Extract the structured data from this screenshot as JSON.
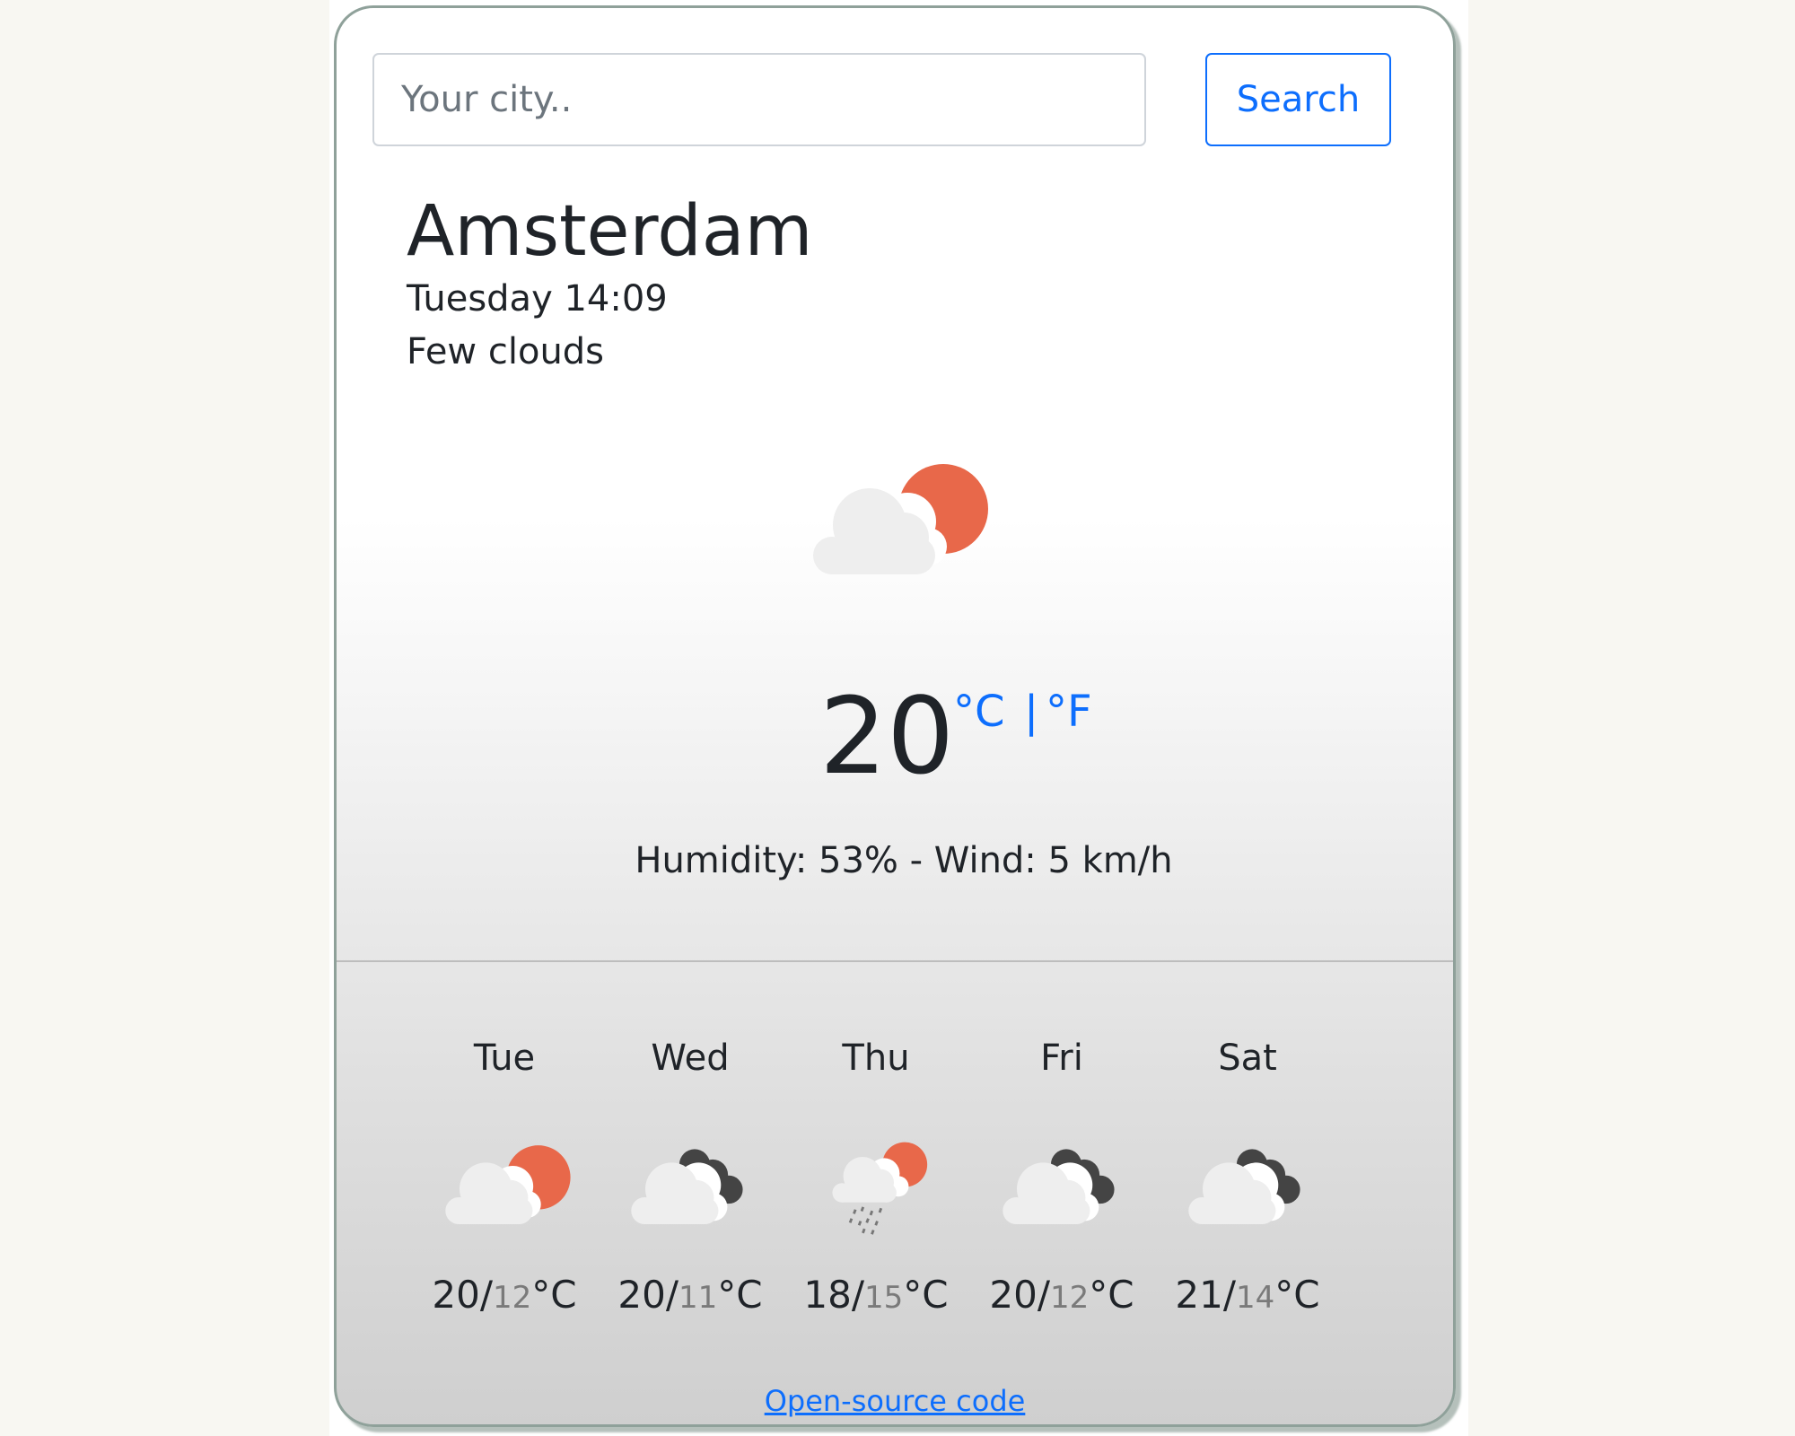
{
  "search": {
    "placeholder": "Your city..",
    "value": "",
    "button_label": "Search"
  },
  "current": {
    "city": "Amsterdam",
    "datetime": "Tuesday 14:09",
    "description": "Few clouds",
    "icon": "few-clouds-day-icon",
    "temperature": "20",
    "unit_celsius": "°C",
    "unit_separator": "|",
    "unit_fahrenheit": "°F",
    "details": "Humidity: 53% - Wind: 5 km/h"
  },
  "forecast": [
    {
      "day": "Tue",
      "icon": "few-clouds-day-icon",
      "high": "20",
      "low": "12",
      "unit": "°C"
    },
    {
      "day": "Wed",
      "icon": "broken-clouds-icon",
      "high": "20",
      "low": "11",
      "unit": "°C"
    },
    {
      "day": "Thu",
      "icon": "rain-day-icon",
      "high": "18",
      "low": "15",
      "unit": "°C"
    },
    {
      "day": "Fri",
      "icon": "broken-clouds-icon",
      "high": "20",
      "low": "12",
      "unit": "°C"
    },
    {
      "day": "Sat",
      "icon": "broken-clouds-icon",
      "high": "21",
      "low": "14",
      "unit": "°C"
    }
  ],
  "footer": {
    "link_label": "Open-source code"
  },
  "colors": {
    "accent": "#0d6efd",
    "sun": "#e8684a",
    "cloud": "#eeeeee",
    "dark_cloud": "#444444"
  }
}
